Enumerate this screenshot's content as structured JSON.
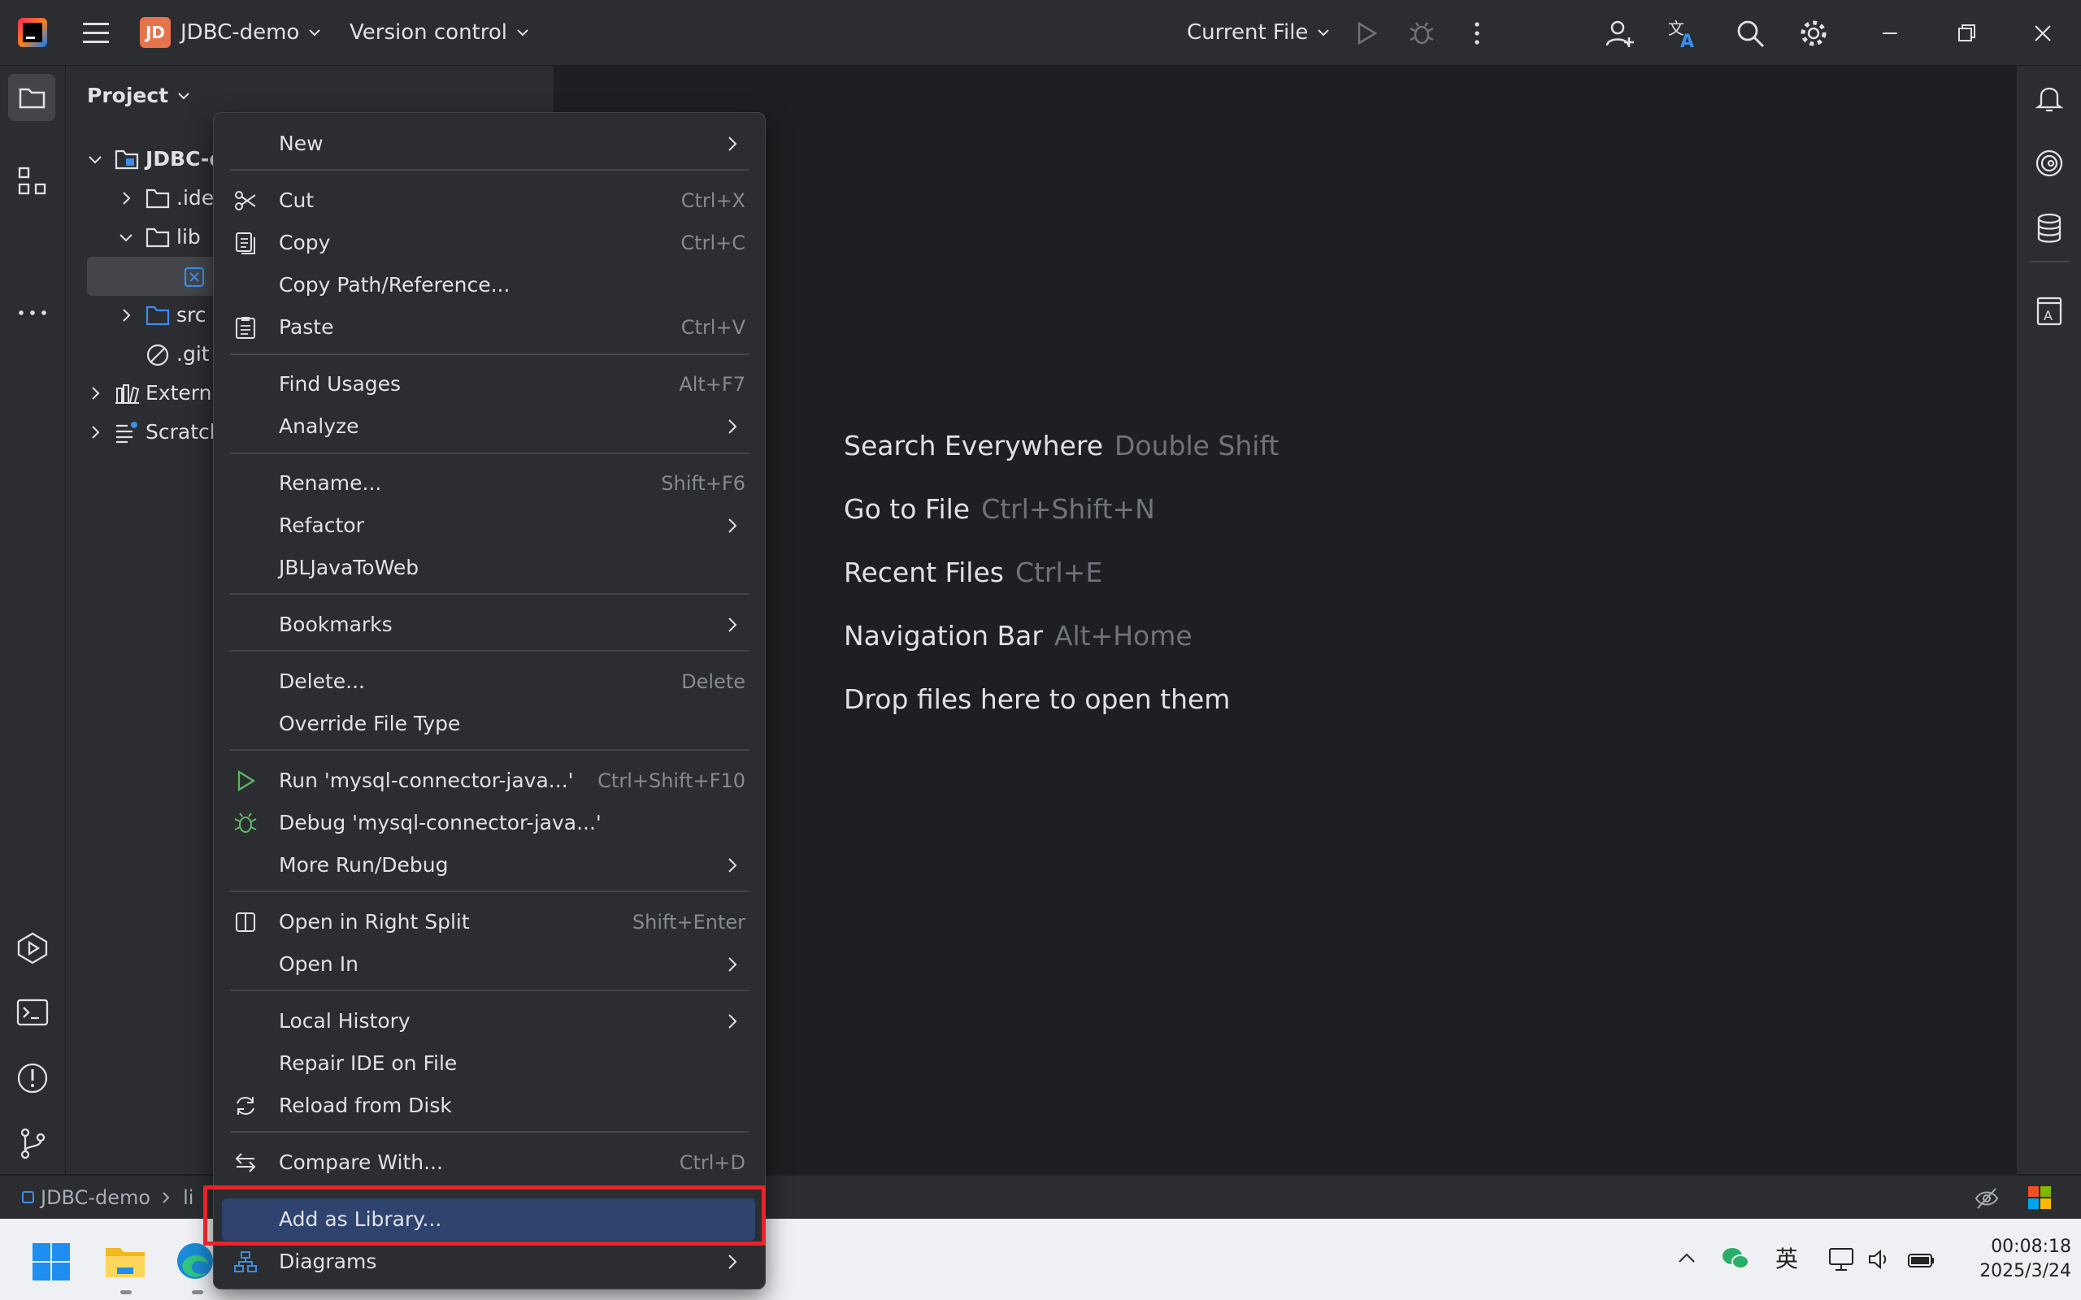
{
  "titlebar": {
    "project_badge": "JD",
    "project_name": "JDBC-demo",
    "version_control": "Version control",
    "run_config": "Current File"
  },
  "project_panel": {
    "title": "Project",
    "tree": [
      {
        "label": "JDBC-d",
        "icon": "module-folder-icon"
      },
      {
        "label": ".ide",
        "icon": "folder-icon"
      },
      {
        "label": "lib",
        "icon": "folder-icon"
      },
      {
        "label": "",
        "icon": "jar-file-icon"
      },
      {
        "label": "src",
        "icon": "source-folder-icon"
      },
      {
        "label": ".git",
        "icon": "ignored-file-icon"
      },
      {
        "label": "Externa",
        "icon": "library-icon"
      },
      {
        "label": "Scratch",
        "icon": "scratch-icon"
      }
    ]
  },
  "editor": {
    "hints": [
      {
        "label": "Search Everywhere",
        "key": "Double Shift"
      },
      {
        "label": "Go to File",
        "key": "Ctrl+Shift+N"
      },
      {
        "label": "Recent Files",
        "key": "Ctrl+E"
      },
      {
        "label": "Navigation Bar",
        "key": "Alt+Home"
      },
      {
        "label": "Drop files here to open them",
        "key": ""
      }
    ]
  },
  "context_menu": {
    "items": [
      {
        "label": "New",
        "shortcut": "",
        "submenu": true
      },
      {
        "label": "Cut",
        "shortcut": "Ctrl+X",
        "icon": "scissors-icon"
      },
      {
        "label": "Copy",
        "shortcut": "Ctrl+C",
        "icon": "copy-icon"
      },
      {
        "label": "Copy Path/Reference...",
        "shortcut": ""
      },
      {
        "label": "Paste",
        "shortcut": "Ctrl+V",
        "icon": "clipboard-icon"
      },
      {
        "label": "Find Usages",
        "shortcut": "Alt+F7"
      },
      {
        "label": "Analyze",
        "shortcut": "",
        "submenu": true
      },
      {
        "label": "Rename...",
        "shortcut": "Shift+F6"
      },
      {
        "label": "Refactor",
        "shortcut": "",
        "submenu": true
      },
      {
        "label": "JBLJavaToWeb",
        "shortcut": ""
      },
      {
        "label": "Bookmarks",
        "shortcut": "",
        "submenu": true
      },
      {
        "label": "Delete...",
        "shortcut": "Delete"
      },
      {
        "label": "Override File Type",
        "shortcut": ""
      },
      {
        "label": "Run 'mysql-connector-java...'",
        "shortcut": "Ctrl+Shift+F10",
        "icon": "run-icon"
      },
      {
        "label": "Debug 'mysql-connector-java...'",
        "shortcut": "",
        "icon": "debug-icon"
      },
      {
        "label": "More Run/Debug",
        "shortcut": "",
        "submenu": true
      },
      {
        "label": "Open in Right Split",
        "shortcut": "Shift+Enter",
        "icon": "split-icon"
      },
      {
        "label": "Open In",
        "shortcut": "",
        "submenu": true
      },
      {
        "label": "Local History",
        "shortcut": "",
        "submenu": true
      },
      {
        "label": "Repair IDE on File",
        "shortcut": ""
      },
      {
        "label": "Reload from Disk",
        "shortcut": "",
        "icon": "reload-icon"
      },
      {
        "label": "Compare With...",
        "shortcut": "Ctrl+D",
        "icon": "compare-icon"
      },
      {
        "label": "Add as Library...",
        "shortcut": "",
        "selected": true
      },
      {
        "label": "Diagrams",
        "shortcut": "",
        "submenu": true,
        "icon": "diagram-icon"
      }
    ]
  },
  "statusbar": {
    "breadcrumb_project": "JDBC-demo",
    "breadcrumb_next": "li"
  },
  "taskbar": {
    "ime": "英",
    "time": "00:08:18",
    "date": "2025/3/24"
  }
}
